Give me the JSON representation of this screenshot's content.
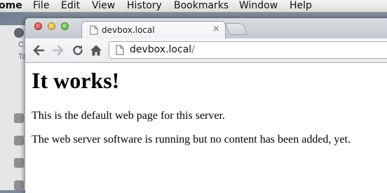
{
  "menubar": {
    "app_name": "ome",
    "items": [
      "File",
      "Edit",
      "View",
      "History",
      "Bookmarks",
      "Window",
      "Help"
    ]
  },
  "background_window": {
    "fragments": [
      "C",
      "Ta"
    ]
  },
  "browser": {
    "tab": {
      "title": "devbox.local",
      "close_symbol": "×",
      "favicon": "page-icon"
    },
    "toolbar": {
      "back_icon": "back-arrow-icon",
      "forward_icon": "forward-arrow-icon",
      "reload_icon": "reload-icon",
      "home_icon": "home-icon"
    },
    "omnibox": {
      "host": "devbox.local",
      "path": "/"
    }
  },
  "page": {
    "heading": "It works!",
    "paragraphs": [
      "This is the default web page for this server.",
      "The web server software is running but no content has been added, yet."
    ]
  },
  "colors": {
    "close": "#d8332a",
    "minimize": "#e0a020",
    "maximize": "#4fa72f"
  }
}
